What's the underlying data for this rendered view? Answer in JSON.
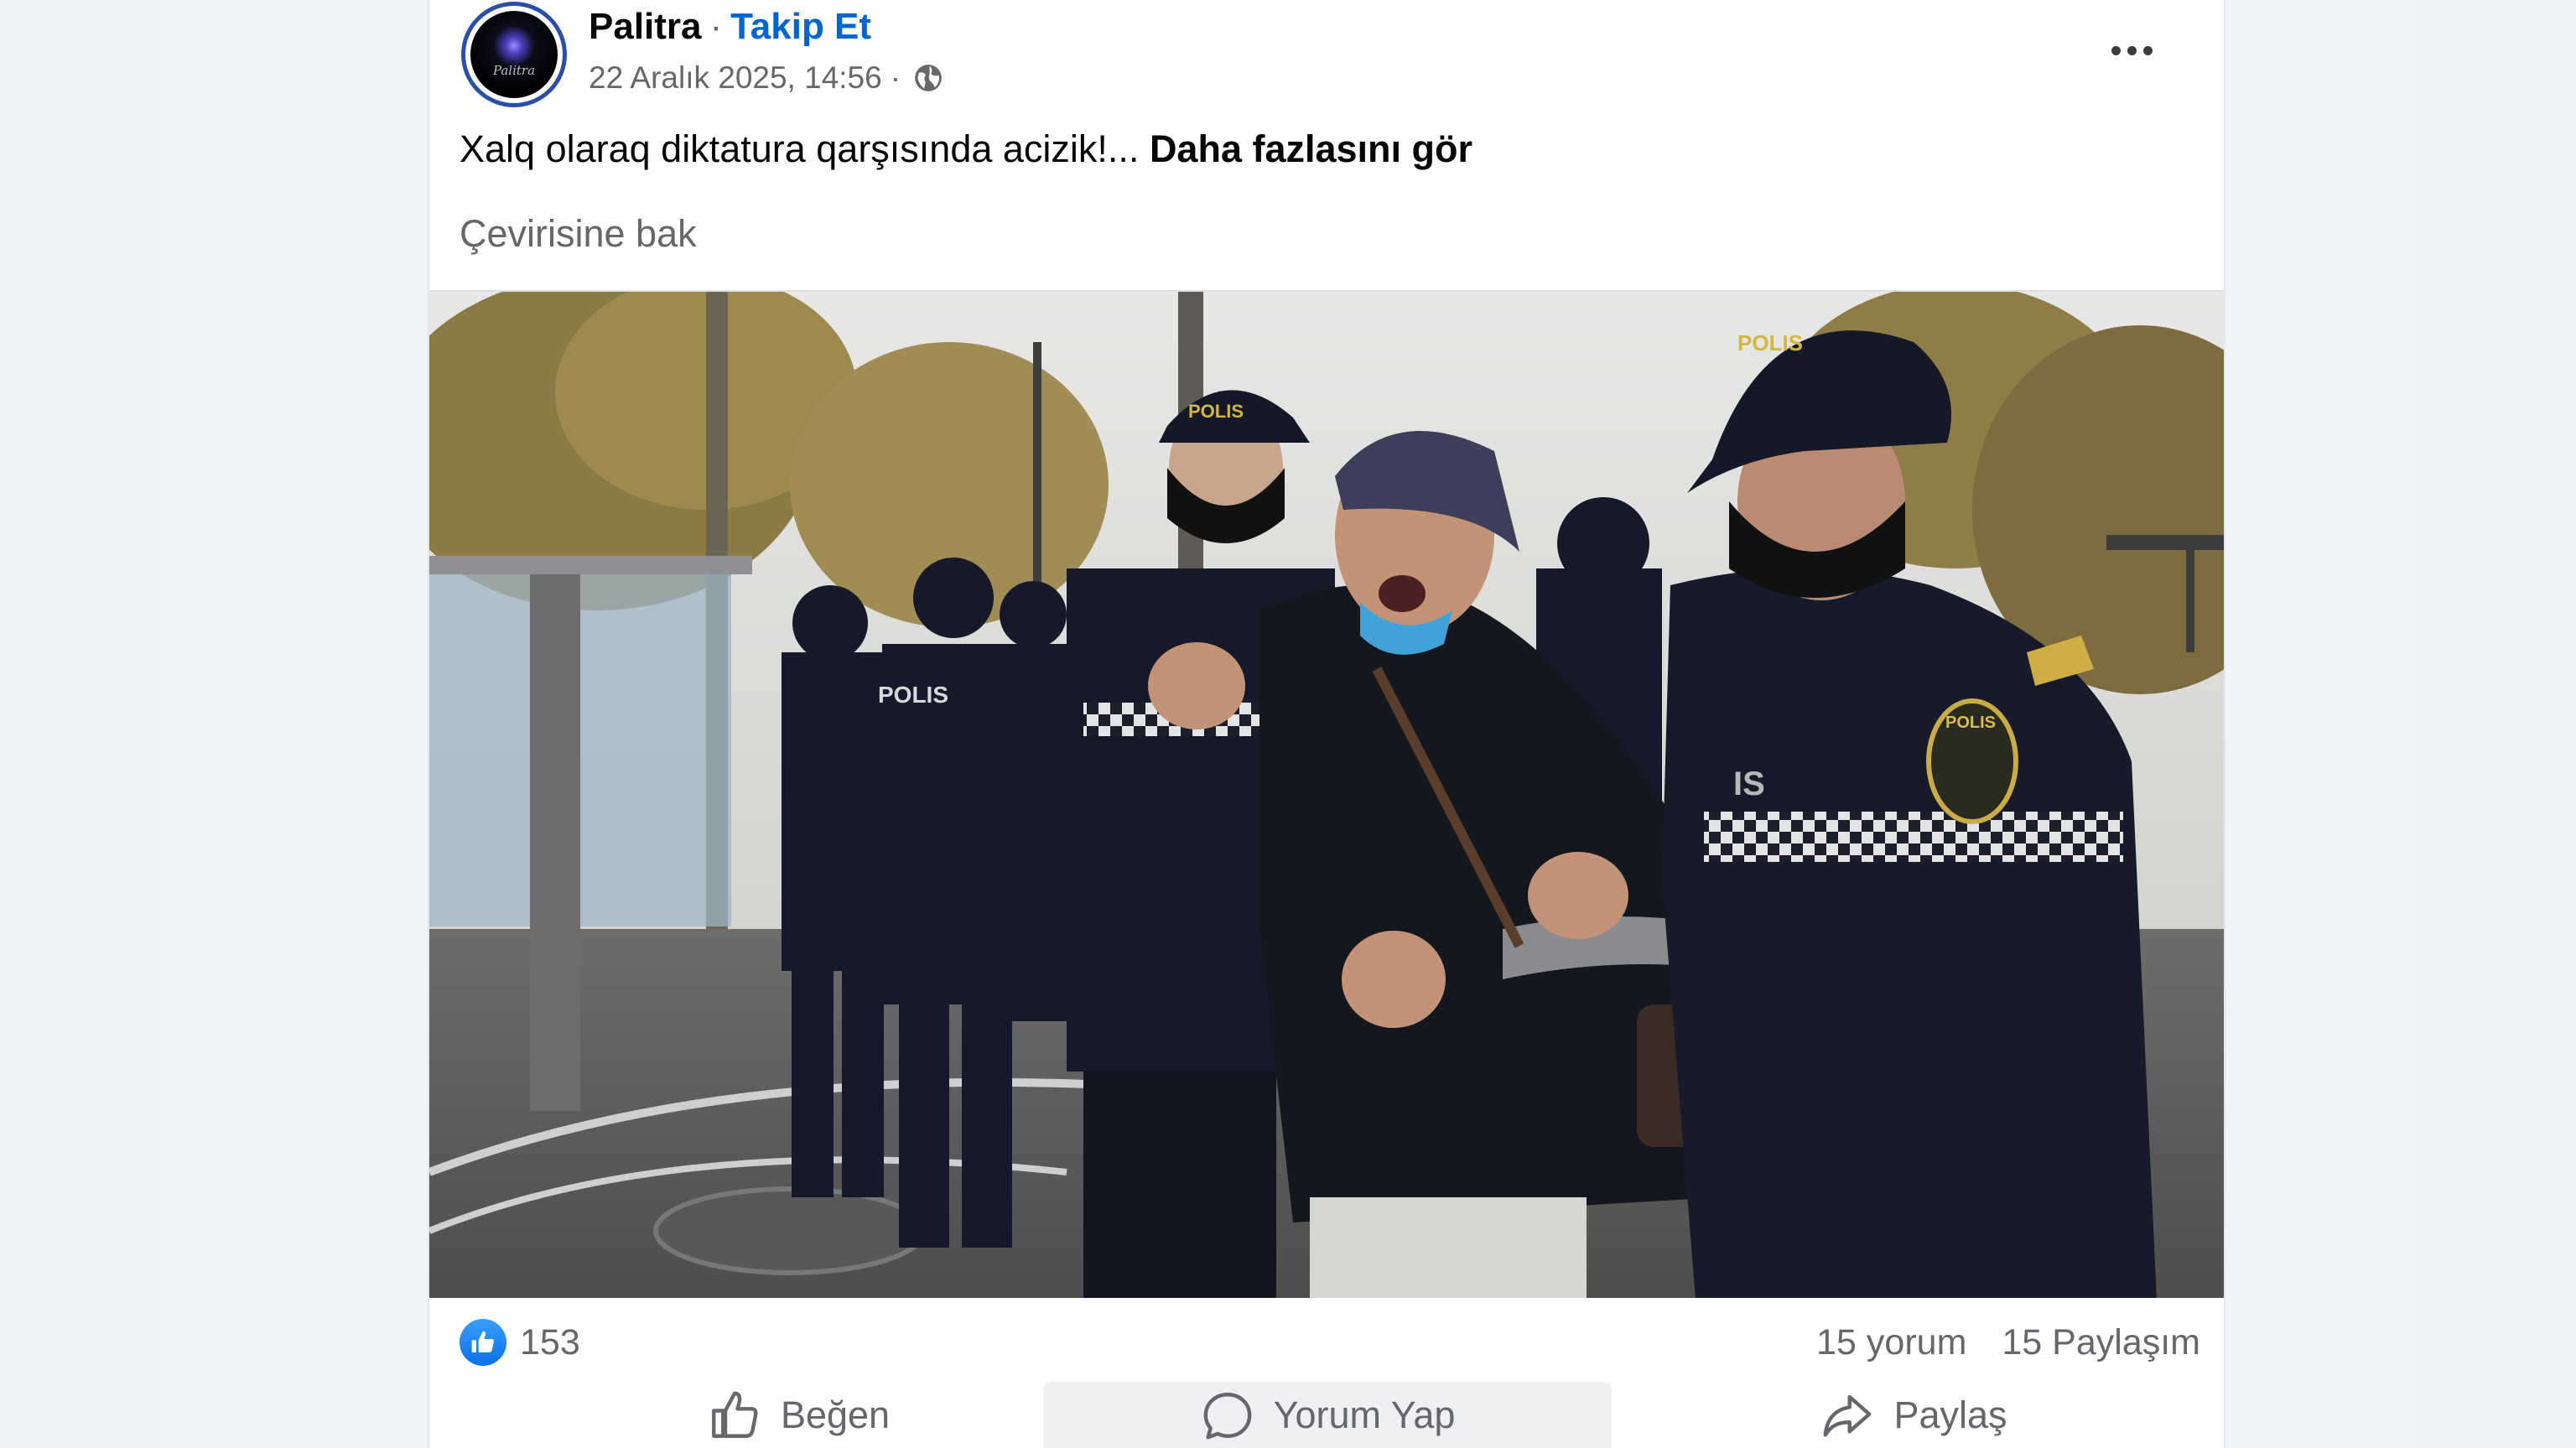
{
  "post": {
    "author": "Palitra",
    "separator": "·",
    "follow_label": "Takip Et",
    "timestamp": "22 Aralık 2025, 14:56",
    "separator2": "·",
    "privacy_icon": "globe-icon",
    "avatar_text": "Palitra",
    "text": "Xalq olaraq diktatura qarşısında acizik!...",
    "see_more_label": "Daha fazlasını gör",
    "translate_label": "Çevirisine bak",
    "more_icon": "more-options-icon"
  },
  "photo_patches": {
    "left_cop": "POLIS",
    "right_cop_cap": "POLIS",
    "right_cop_badge": "POLIS",
    "right_cop_chest": "IS",
    "center_cop_cap": "POLIS"
  },
  "stats": {
    "like_count": "153",
    "comments": "15 yorum",
    "shares": "15 Paylaşım"
  },
  "actions": {
    "like_label": "Beğen",
    "comment_label": "Yorum Yap",
    "share_label": "Paylaş"
  },
  "colors": {
    "accent": "#0064d1",
    "secondary_text": "#65676b",
    "like_blue": "#0a6fe6"
  }
}
